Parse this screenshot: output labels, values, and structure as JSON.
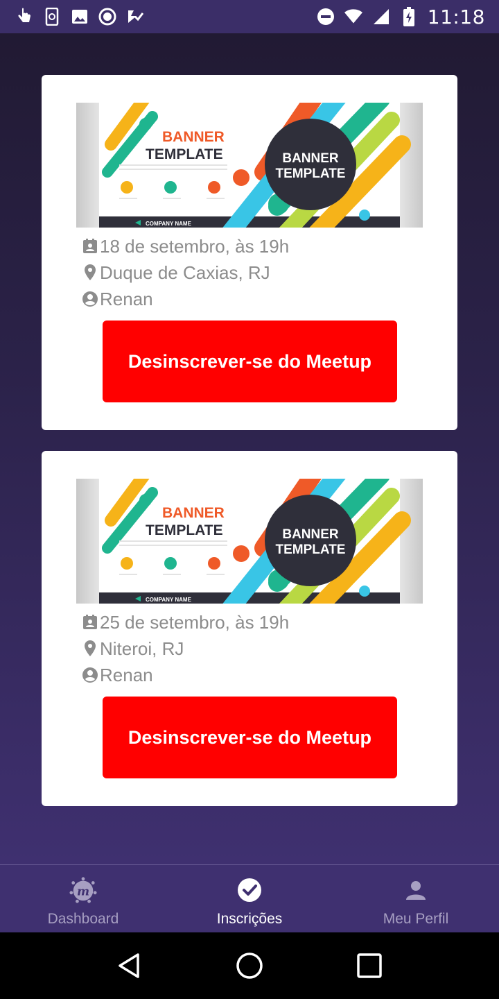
{
  "status_bar": {
    "time": "11:18",
    "left_icons": [
      "touch-icon",
      "sync-phone-icon",
      "image-icon",
      "circle-app-icon",
      "checklist-icon"
    ],
    "right_icons": [
      "do-not-disturb-icon",
      "wifi-icon",
      "signal-icon",
      "battery-charging-icon"
    ]
  },
  "meetups": [
    {
      "banner": {
        "title_line1": "BANNER",
        "title_line2": "TEMPLATE",
        "circle_line1": "BANNER",
        "circle_line2": "TEMPLATE",
        "company": "COMPANY NAME"
      },
      "date": "18 de setembro, às 19h",
      "location": "Duque de Caxias, RJ",
      "organizer": "Renan",
      "button_label": "Desinscrever-se do Meetup"
    },
    {
      "banner": {
        "title_line1": "BANNER",
        "title_line2": "TEMPLATE",
        "circle_line1": "BANNER",
        "circle_line2": "TEMPLATE",
        "company": "COMPANY NAME"
      },
      "date": "25 de setembro, às 19h",
      "location": "Niteroi, RJ",
      "organizer": "Renan",
      "button_label": "Desinscrever-se do Meetup"
    }
  ],
  "bottom_nav": {
    "items": [
      {
        "label": "Dashboard",
        "icon": "meetup-logo-icon",
        "active": false
      },
      {
        "label": "Inscrições",
        "icon": "check-circle-icon",
        "active": true
      },
      {
        "label": "Meu Perfil",
        "icon": "person-icon",
        "active": false
      }
    ]
  },
  "colors": {
    "accent_button": "#ff0000",
    "header": "#3b2e68",
    "nav_bg": "#3f3070",
    "info_text": "#8c8c8c"
  }
}
